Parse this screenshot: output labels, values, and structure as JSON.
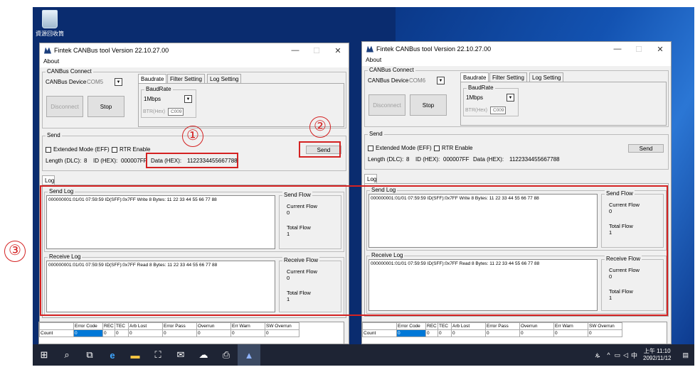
{
  "desktop": {
    "recycle_label": "資源回收筒"
  },
  "windows": [
    {
      "title": "Fintek CANBus tool Version 22.10.27.00",
      "menu": "About",
      "canbus_connect": "CANBus Connect",
      "device_label": "CANBus Device",
      "device_value": "COM5",
      "disconnect": "Disconnect",
      "stop": "Stop",
      "tabs": [
        "Baudrate",
        "Filter Setting",
        "Log Setting"
      ],
      "baudrate_group": "BaudRate",
      "baudrate_value": "1Mbps",
      "btr_label": "BTR(Hex)",
      "btr_value": "C009",
      "send_group": "Send",
      "extended": "Extended Mode (EFF)",
      "rtr": "RTR Enable",
      "send_button": "Send",
      "length_label": "Length (DLC):",
      "length_value": "8",
      "id_label": "ID (HEX):",
      "id_value": "000007FF",
      "data_label": "Data (HEX):",
      "data_value": "1122334455667788",
      "log_tab": "Log",
      "send_log": "Send Log",
      "send_log_text": "000000001:01/01 07:59:59 ID(SFF):0x7FF Write 8 Bytes: 11 22 33 44 55 66 77 88",
      "send_flow": "Send Flow",
      "current_flow": "Current Flow",
      "current_flow_val": "0",
      "total_flow": "Total Flow",
      "send_total_val": "1",
      "receive_log": "Receive Log",
      "receive_log_text": "000000001:01/01 07:59:59 ID(SFF):0x7FF Read 8 Bytes: 11 22 33 44 55 66 77 88",
      "receive_flow": "Receive Flow",
      "recv_current_val": "0",
      "recv_total_val": "1"
    },
    {
      "title": "Fintek CANBus tool Version 22.10.27.00",
      "menu": "About",
      "canbus_connect": "CANBus Connect",
      "device_label": "CANBus Device",
      "device_value": "COM6",
      "disconnect": "Disconnect",
      "stop": "Stop",
      "tabs": [
        "Baudrate",
        "Filter Setting",
        "Log Setting"
      ],
      "baudrate_group": "BaudRate",
      "baudrate_value": "1Mbps",
      "btr_label": "BTR(Hex)",
      "btr_value": "C009",
      "send_group": "Send",
      "extended": "Extended Mode (EFF)",
      "rtr": "RTR Enable",
      "send_button": "Send",
      "length_label": "Length (DLC):",
      "length_value": "8",
      "id_label": "ID (HEX):",
      "id_value": "000007FF",
      "data_label": "Data (HEX):",
      "data_value": "1122334455667788",
      "log_tab": "Log",
      "send_log": "Send Log",
      "send_log_text": "000000001:01/01 07:59:59 ID(SFF):0x7FF Write 8 Bytes: 11 22 33 44 55 66 77 88",
      "send_flow": "Send Flow",
      "current_flow": "Current Flow",
      "current_flow_val": "0",
      "total_flow": "Total Flow",
      "send_total_val": "1",
      "receive_log": "Receive Log",
      "receive_log_text": "000000001:01/01 07:59:59 ID(SFF):0x7FF Read 8 Bytes: 11 22 33 44 55 66 77 88",
      "receive_flow": "Receive Flow",
      "recv_current_val": "0",
      "recv_total_val": "1"
    }
  ],
  "stats_header": [
    "",
    "Error Code",
    "REC",
    "TEC",
    "Arb Lost",
    "Error Pass",
    "Overrun",
    "Err Warn",
    "SW Overrun"
  ],
  "stats_row": [
    "Count",
    "0",
    "0",
    "0",
    "0",
    "0",
    "0",
    "0",
    "0"
  ],
  "annotations": {
    "one": "①",
    "two": "②",
    "three": "③"
  },
  "taskbar": {
    "ime": "中",
    "time": "上午 11:10",
    "date": "2092/11/12"
  },
  "colors": {
    "annotation_red": "#d42222",
    "desktop_blue": "#0a2c6f",
    "selection_blue": "#0078d7"
  }
}
